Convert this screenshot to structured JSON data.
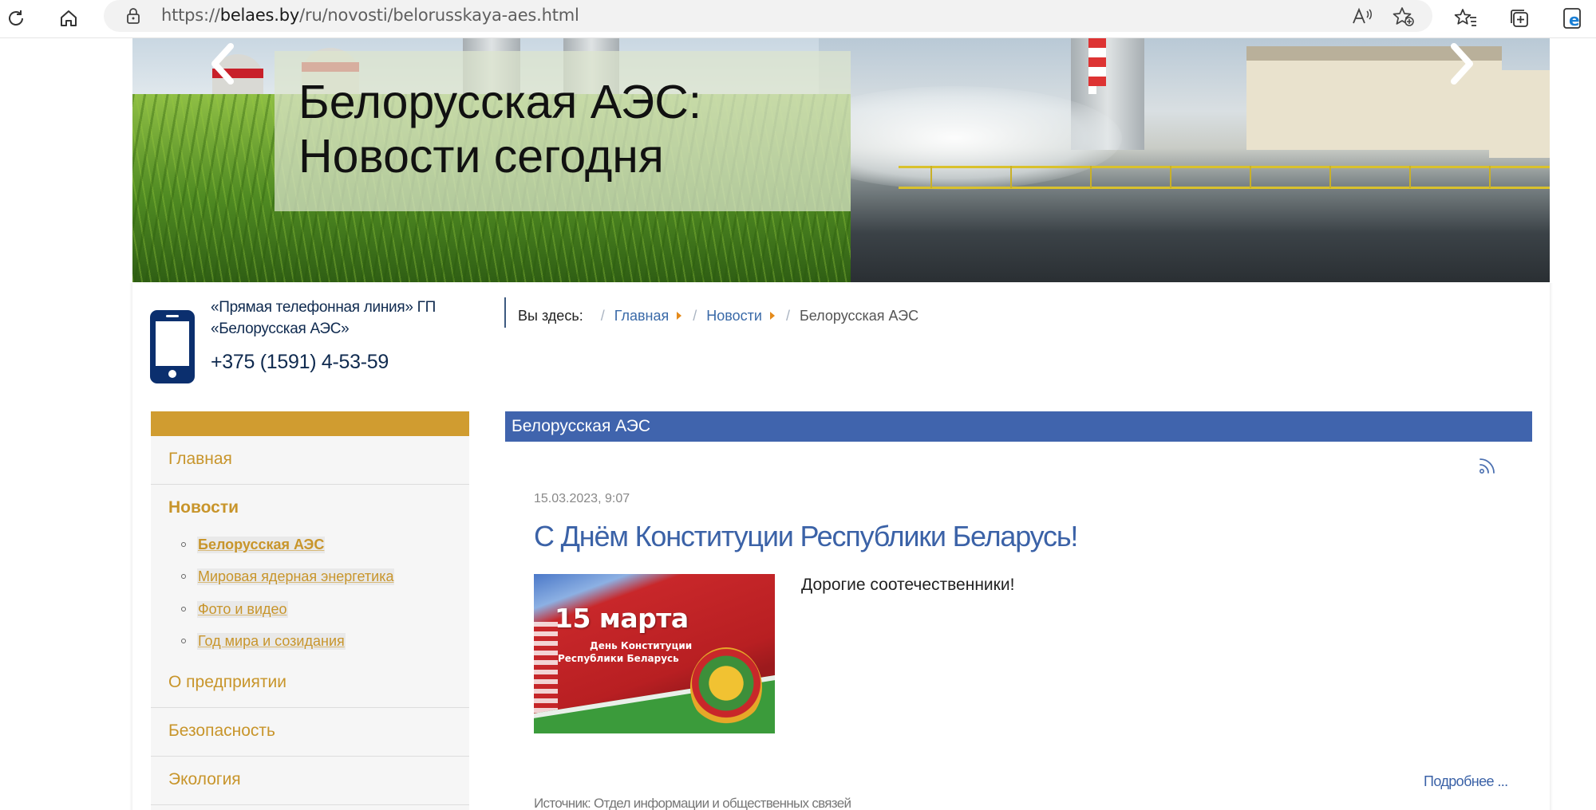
{
  "browser": {
    "url_prefix": "https://",
    "url_domain": "belaes.by",
    "url_path": "/ru/novosti/belorusskaya-aes.html"
  },
  "banner": {
    "title_line1": "Белорусская АЭС:",
    "title_line2": "Новости сегодня"
  },
  "hotline": {
    "label_line1": "«Прямая телефонная линия» ГП",
    "label_line2": "«Белорусская АЭС»",
    "phone": "+375 (1591) 4-53-59"
  },
  "breadcrumb": {
    "prefix": "Вы здесь:",
    "separator": "/",
    "items": [
      "Главная",
      "Новости"
    ],
    "current": "Белорусская АЭС"
  },
  "sidebar": {
    "items": [
      {
        "label": "Главная"
      },
      {
        "label": "Новости",
        "active": true
      },
      {
        "label": "О предприятии"
      },
      {
        "label": "Безопасность"
      },
      {
        "label": "Экология"
      }
    ],
    "sub_items": [
      {
        "label": "Белорусская АЭС",
        "active": true
      },
      {
        "label": "Мировая ядерная энергетика"
      },
      {
        "label": "Фото и видео"
      },
      {
        "label": "Год мира и созидания"
      }
    ]
  },
  "section": {
    "title": "Белорусская АЭС"
  },
  "news": {
    "date": "15.03.2023, 9:07",
    "title": "С Днём Конституции Республики Беларусь!",
    "image_text_line1": "15 марта",
    "image_text_line2": "День Конституции",
    "image_text_line3": "Республики Беларусь",
    "intro": "Дорогие соотечественники!",
    "read_more": "Подробнее ...",
    "source": "Источник: Отдел информации и общественных связей"
  },
  "colors": {
    "accent_gold": "#c8952b",
    "section_blue": "#4064ad",
    "link_blue": "#3b62a7",
    "phone_navy": "#0b2f6e"
  }
}
